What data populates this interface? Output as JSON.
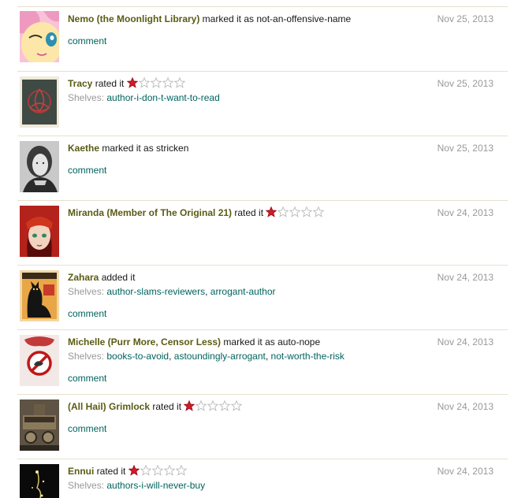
{
  "entries": [
    {
      "user": "Nemo (the Moonlight Library)",
      "action": "marked it as not-an-offensive-name",
      "date": "Nov 25, 2013",
      "comment": "comment",
      "avatar": "pony-avatar"
    },
    {
      "user": "Tracy",
      "action": "rated it",
      "rating": 1,
      "shelves_label": "Shelves:",
      "shelves": [
        "author-i-don-t-want-to-read"
      ],
      "date": "Nov 25, 2013",
      "avatar": "triquetra-avatar"
    },
    {
      "user": "Kaethe",
      "action": "marked it as stricken",
      "date": "Nov 25, 2013",
      "comment": "comment",
      "avatar": "portrait-avatar"
    },
    {
      "user": "Miranda (Member of The Original 21)",
      "action": "rated it",
      "rating": 1,
      "date": "Nov 24, 2013",
      "avatar": "redhead-avatar"
    },
    {
      "user": "Zahara",
      "action": "added it",
      "shelves_label": "Shelves:",
      "shelves": [
        "author-slams-reviewers",
        "arrogant-author"
      ],
      "date": "Nov 24, 2013",
      "comment": "comment",
      "avatar": "chat-noir-avatar"
    },
    {
      "user": "Michelle (Purr More, Censor Less)",
      "action": "marked it as auto-nope",
      "shelves_label": "Shelves:",
      "shelves": [
        "books-to-avoid",
        "astoundingly-arrogant",
        "not-worth-the-risk"
      ],
      "date": "Nov 24, 2013",
      "comment": "comment",
      "avatar": "no-sign-avatar"
    },
    {
      "user": "(All Hail) Grimlock",
      "action": "rated it",
      "rating": 1,
      "date": "Nov 24, 2013",
      "comment": "comment",
      "avatar": "steampunk-avatar"
    },
    {
      "user": "Ennui",
      "action": "rated it",
      "rating": 1,
      "shelves_label": "Shelves:",
      "shelves": [
        "authors-i-will-never-buy"
      ],
      "date": "Nov 24, 2013",
      "avatar": "dark-sparkle-avatar"
    }
  ],
  "colors": {
    "user_link": "#5b5b14",
    "shelf_link": "#00635d",
    "date": "#999999",
    "star_on": "#d11a2a",
    "star_off": "#ffffff",
    "divider": "#e6e1cc"
  }
}
